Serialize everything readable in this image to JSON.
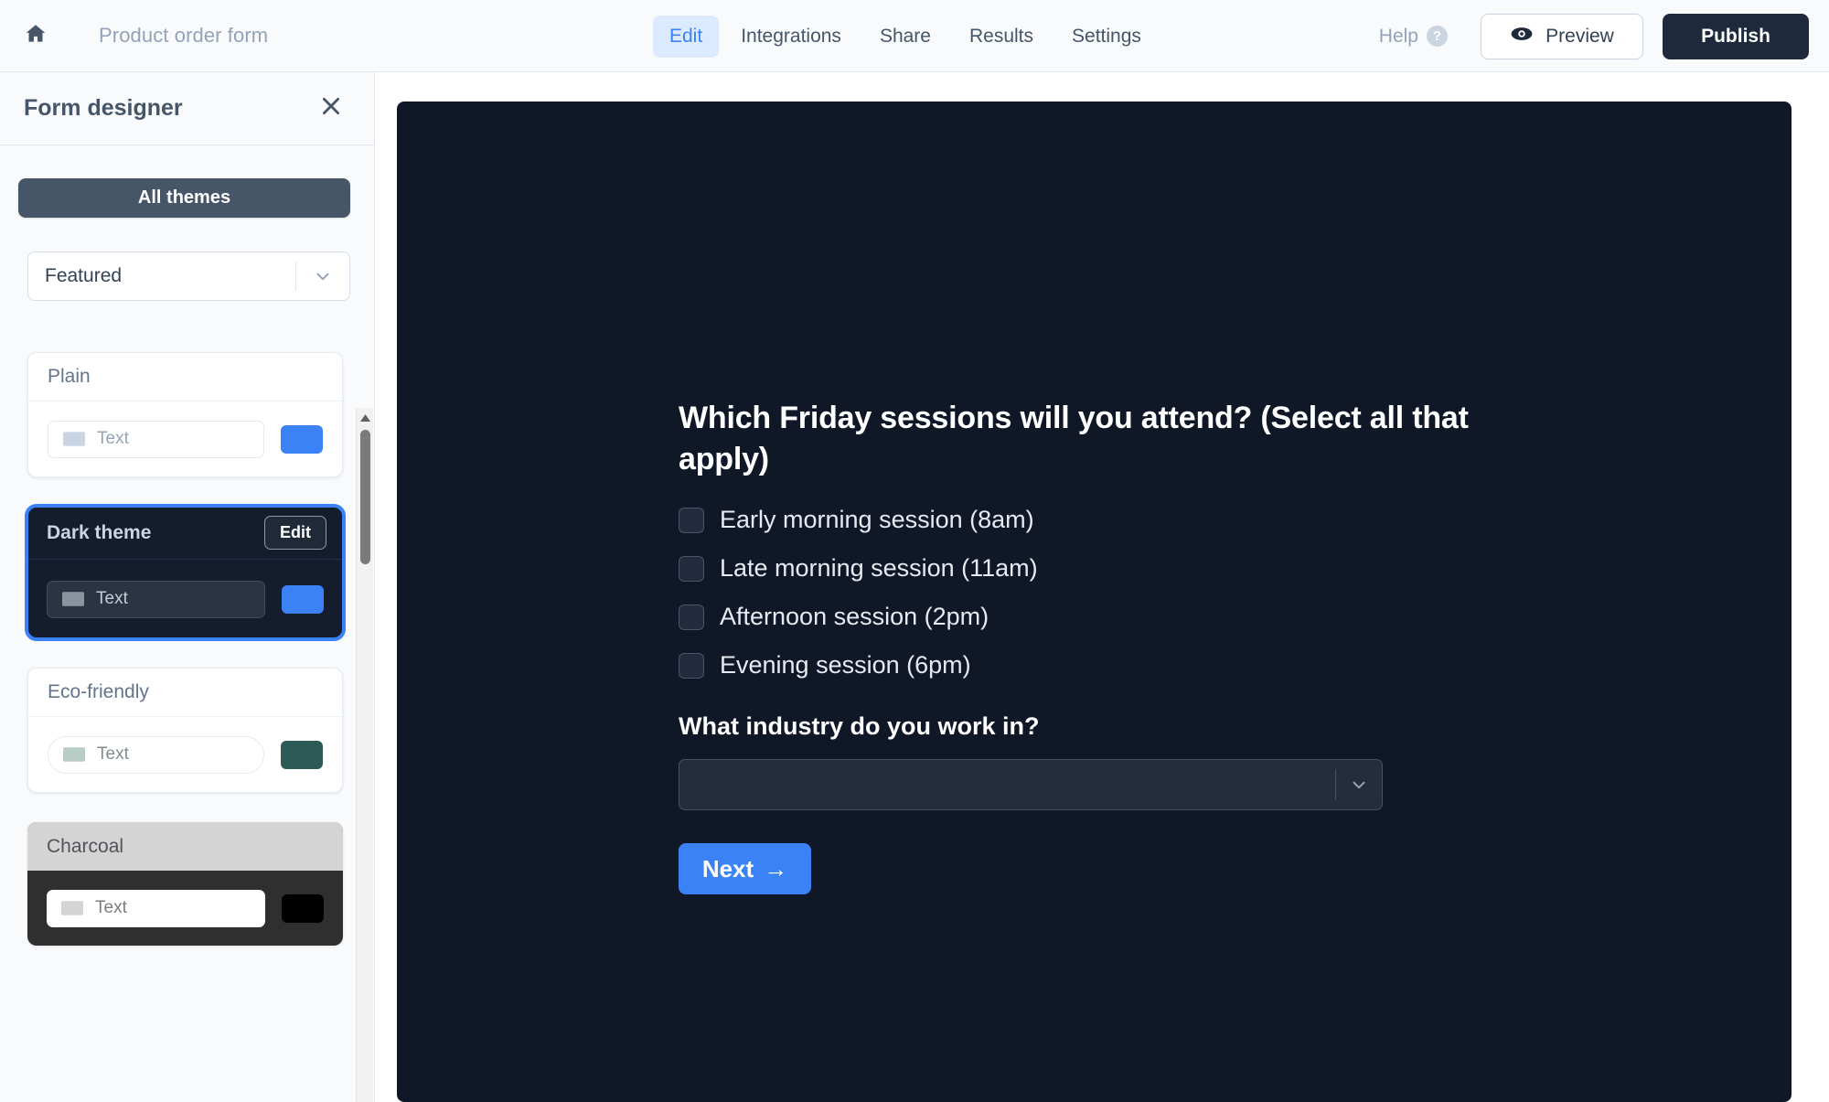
{
  "topbar": {
    "home_icon": "home-icon",
    "form_title": "Product order form",
    "tabs": [
      {
        "label": "Edit",
        "active": true
      },
      {
        "label": "Integrations",
        "active": false
      },
      {
        "label": "Share",
        "active": false
      },
      {
        "label": "Results",
        "active": false
      },
      {
        "label": "Settings",
        "active": false
      }
    ],
    "help_label": "Help",
    "help_badge": "?",
    "preview_label": "Preview",
    "preview_icon": "eye-icon",
    "publish_label": "Publish"
  },
  "sidebar": {
    "title": "Form designer",
    "close_icon": "close-icon",
    "all_themes_label": "All themes",
    "category_select": {
      "value": "Featured",
      "chevron_icon": "chevron-down-icon"
    },
    "themes": [
      {
        "name": "Plain",
        "selected": false,
        "input_placeholder": "Text",
        "accent_color": "#3b82f6",
        "edit_label": null
      },
      {
        "name": "Dark theme",
        "selected": true,
        "input_placeholder": "Text",
        "accent_color": "#3b82f6",
        "edit_label": "Edit"
      },
      {
        "name": "Eco-friendly",
        "selected": false,
        "input_placeholder": "Text",
        "accent_color": "#2d5a57",
        "edit_label": null
      },
      {
        "name": "Charcoal",
        "selected": false,
        "input_placeholder": "Text",
        "accent_color": "#000000",
        "edit_label": null
      }
    ]
  },
  "form_preview": {
    "background_color": "#101827",
    "question_title": "Which Friday sessions will you attend? (Select all that apply)",
    "checkbox_options": [
      {
        "label": "Early morning session (8am)",
        "checked": false
      },
      {
        "label": "Late morning session (11am)",
        "checked": false
      },
      {
        "label": "Afternoon session (2pm)",
        "checked": false
      },
      {
        "label": "Evening session (6pm)",
        "checked": false
      }
    ],
    "industry_question": "What industry do you work in?",
    "industry_select": {
      "value": "",
      "chevron_icon": "chevron-down-icon"
    },
    "next_label": "Next",
    "next_arrow": "→",
    "accent_color": "#3b82f6"
  }
}
